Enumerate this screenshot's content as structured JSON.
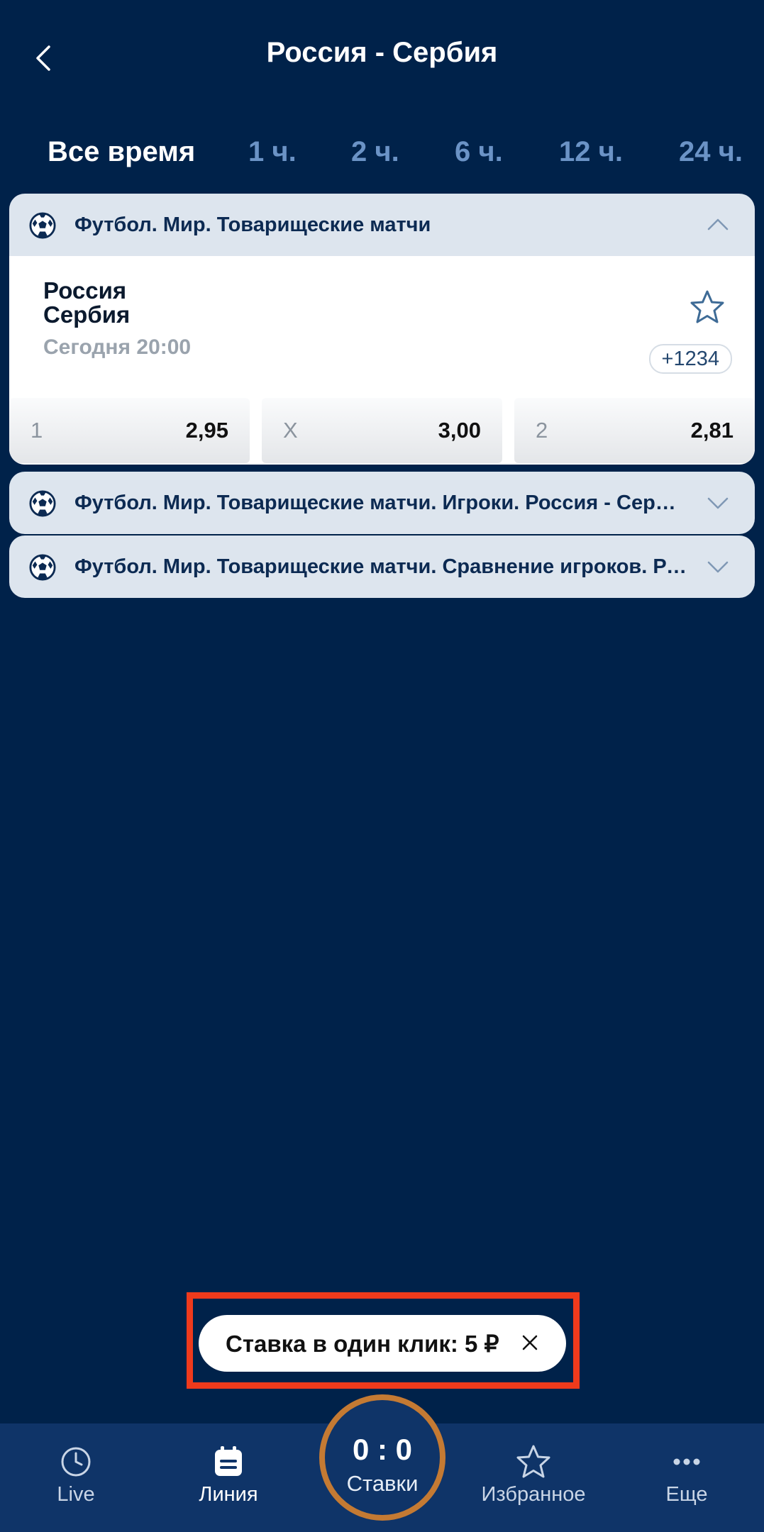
{
  "header": {
    "title": "Россия - Сербия"
  },
  "tabs": [
    {
      "label": "Все время"
    },
    {
      "label": "1 ч."
    },
    {
      "label": "2 ч."
    },
    {
      "label": "6 ч."
    },
    {
      "label": "12 ч."
    },
    {
      "label": "24 ч."
    }
  ],
  "groups": [
    {
      "title": "Футбол. Мир. Товарищеские матчи",
      "expanded": true,
      "match": {
        "team1": "Россия",
        "team2": "Сербия",
        "time": "Сегодня 20:00",
        "more": "+1234",
        "odds": [
          {
            "label": "1",
            "value": "2,95"
          },
          {
            "label": "X",
            "value": "3,00"
          },
          {
            "label": "2",
            "value": "2,81"
          }
        ]
      }
    },
    {
      "title": "Футбол. Мир. Товарищеские матчи. Игроки. Россия - Сербия",
      "expanded": false
    },
    {
      "title": "Футбол. Мир. Товарищеские матчи. Сравнение игроков. Россия - Сербия",
      "expanded": false
    }
  ],
  "quick_bet": {
    "label": "Ставка в один клик: 5 ₽"
  },
  "bottom_nav": {
    "live": "Live",
    "line": "Линия",
    "bets_score": "0 : 0",
    "bets": "Ставки",
    "favorites": "Избранное",
    "more": "Еще"
  },
  "colors": {
    "background": "#00224a",
    "group_header": "#dde5ee",
    "tab_inactive": "#6b93c6",
    "highlight_frame": "#ef3a1c",
    "bets_ring": "#c47a33"
  }
}
